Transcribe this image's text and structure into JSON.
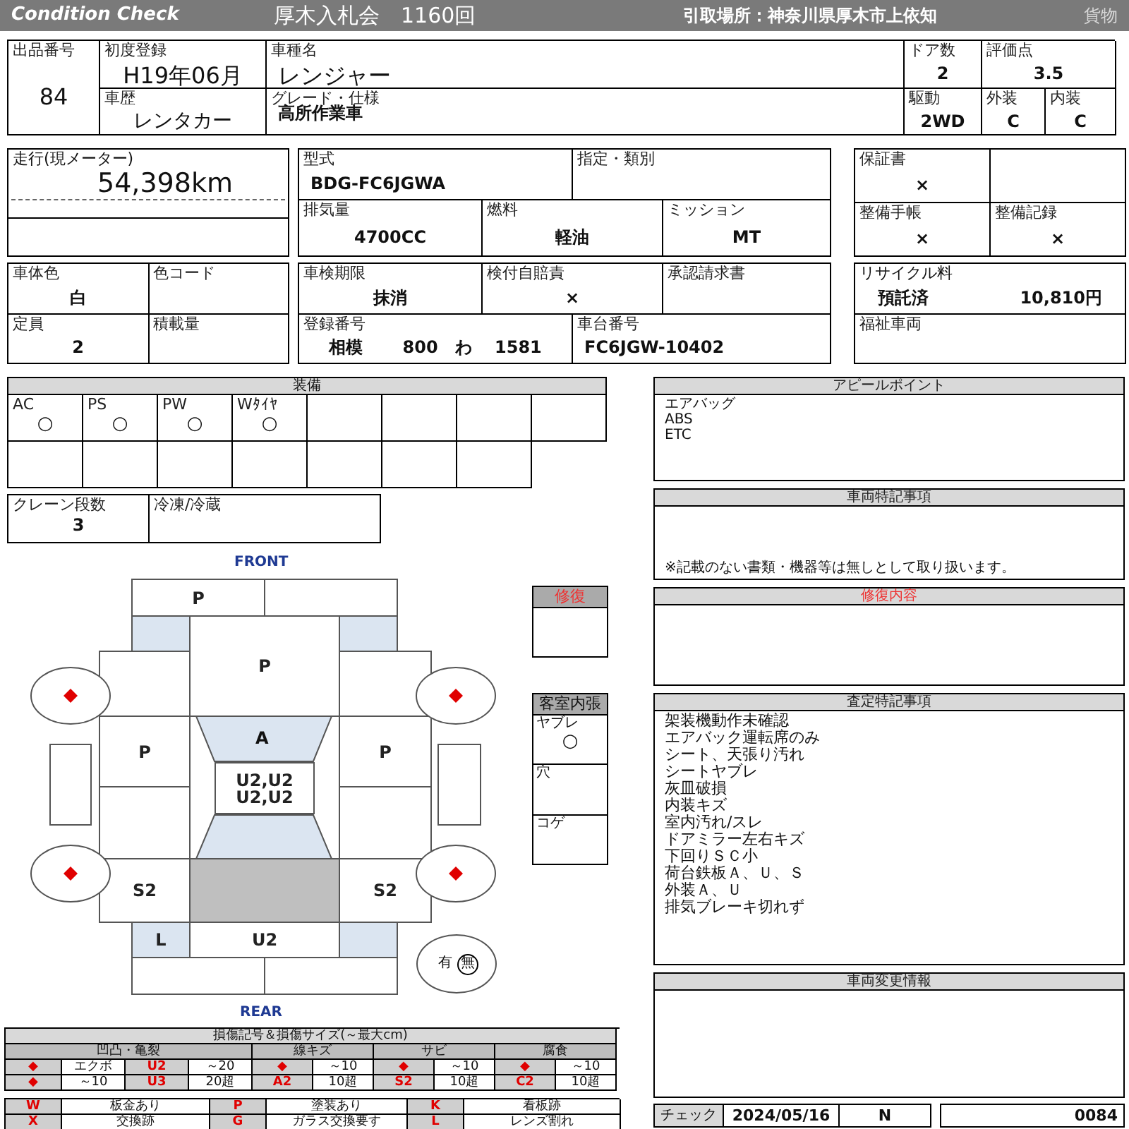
{
  "header": {
    "title": "Condition Check",
    "auction": "厚木入札会　1160回",
    "pickup": "引取場所：神奈川県厚木市上依知",
    "category": "貨物"
  },
  "top": [
    {
      "label": "出品番号",
      "value": "84"
    },
    {
      "label": "初度登録",
      "value": "H19年06月"
    },
    {
      "label": "車種名",
      "value": "レンジャー"
    },
    {
      "label": "ドア数",
      "value": "2"
    },
    {
      "label": "評価点",
      "value": "3.5"
    },
    {
      "label": "車歴",
      "value": "レンタカー"
    },
    {
      "label": "グレード・仕様",
      "value": "高所作業車"
    },
    {
      "label": "駆動",
      "value": "2WD"
    },
    {
      "label": "外装",
      "value": "C"
    },
    {
      "label": "内装",
      "value": "C"
    }
  ],
  "mileage": {
    "label": "走行(現メーター)",
    "value": "54,398km"
  },
  "specs": [
    {
      "label": "型式",
      "value": "BDG-FC6JGWA"
    },
    {
      "label": "指定・類別"
    },
    {
      "label": "排気量",
      "value": "4700CC"
    },
    {
      "label": "燃料",
      "value": "軽油"
    },
    {
      "label": "ミッション",
      "value": "MT"
    }
  ],
  "documents": [
    {
      "label": "保証書",
      "value": "×"
    },
    {
      "label": "整備手帳",
      "value": "×"
    },
    {
      "label": "整備記録",
      "value": "×"
    }
  ],
  "body": [
    {
      "label": "車体色",
      "value": "白"
    },
    {
      "label": "色コード"
    },
    {
      "label": "定員",
      "value": "2"
    },
    {
      "label": "積載量"
    }
  ],
  "registration": [
    {
      "label": "車検期限",
      "value": "抹消"
    },
    {
      "label": "検付自賠責",
      "value": "×"
    },
    {
      "label": "承認請求書"
    },
    {
      "label": "登録番号",
      "value": "相模　　 800　わ　 1581"
    },
    {
      "label": "車台番号",
      "value": "FC6JGW-10402"
    }
  ],
  "recycle": {
    "label": "リサイクル料",
    "status": "預託済",
    "amount": "10,810円"
  },
  "welfare": {
    "label": "福祉車両"
  },
  "equipment": {
    "title": "装備",
    "items": [
      {
        "label": "AC",
        "value": "○"
      },
      {
        "label": "PS",
        "value": "○"
      },
      {
        "label": "PW",
        "value": "○"
      },
      {
        "label": "Wﾀｲﾔ",
        "value": "○"
      }
    ]
  },
  "crane": [
    {
      "label": "クレーン段数",
      "value": "3"
    },
    {
      "label": "冷凍/冷蔵"
    }
  ],
  "diagram": {
    "front_label": "FRONT",
    "rear_label": "REAR",
    "panels": {
      "front_bumper_left": [
        "P"
      ],
      "hood": [
        "P"
      ],
      "front_door_left": [
        "P"
      ],
      "front_door_right": [
        "P"
      ],
      "windshield": [
        "A"
      ],
      "roof": [
        "U2,U2",
        "U2,U2"
      ],
      "quarter_left": [
        "S2"
      ],
      "quarter_right": [
        "S2"
      ],
      "taillight_left": [
        "L"
      ],
      "tailgate": [
        "U2"
      ]
    },
    "spare": [
      {
        "text": "有",
        "selected": false
      },
      {
        "text": "無",
        "selected": true
      }
    ],
    "repair_box": {
      "title": "修復",
      "highlight": true
    },
    "interior": {
      "title": "客室内張",
      "items": [
        {
          "label": "ヤブレ",
          "value": "○"
        },
        {
          "label": "穴"
        },
        {
          "label": "コゲ"
        }
      ]
    }
  },
  "legend": {
    "title": "損傷記号＆損傷サイズ(～最大cm)",
    "groups": [
      "凹凸・亀裂",
      "線キズ",
      "サビ",
      "腐食"
    ],
    "rows": [
      [
        "◆",
        "エクボ",
        "U2",
        "～20",
        "◆",
        "～10",
        "◆",
        "～10",
        "◆",
        "～10"
      ],
      [
        "◆",
        "～10",
        "U3",
        "20超",
        "A2",
        "10超",
        "S2",
        "10超",
        "C2",
        "10超"
      ]
    ],
    "codes": [
      {
        "code": "W",
        "text": "板金あり"
      },
      {
        "code": "P",
        "text": "塗装あり"
      },
      {
        "code": "K",
        "text": "看板跡"
      },
      {
        "code": "X",
        "text": "交換跡"
      },
      {
        "code": "G",
        "text": "ガラス交換要す"
      },
      {
        "code": "L",
        "text": "レンズ割れ"
      }
    ]
  },
  "panels": [
    {
      "title": "アピールポイント",
      "highlight": false,
      "lines": [
        "エアバッグ",
        "ABS",
        "ETC"
      ]
    },
    {
      "title": "車両特記事項",
      "highlight": false,
      "note": "※記載のない書類・機器等は無しとして取り扱います。"
    },
    {
      "title": "修復内容",
      "highlight": true
    },
    {
      "title": "査定特記事項",
      "highlight": false,
      "lines": [
        "架装機動作未確認",
        "エアバック運転席のみ",
        "シート、天張り汚れ",
        "シートヤブレ",
        "灰皿破損",
        "内装キズ",
        "室内汚れ/スレ",
        "ドアミラー左右キズ",
        "下回りＳＣ小",
        "荷台鉄板Ａ、Ｕ、Ｓ",
        "外装Ａ、Ｕ",
        "排気ブレーキ切れず"
      ]
    },
    {
      "title": "車両変更情報",
      "highlight": false
    }
  ],
  "footer": {
    "label": "チェック",
    "date": "2024/05/16",
    "code": "N",
    "number": "0084"
  }
}
